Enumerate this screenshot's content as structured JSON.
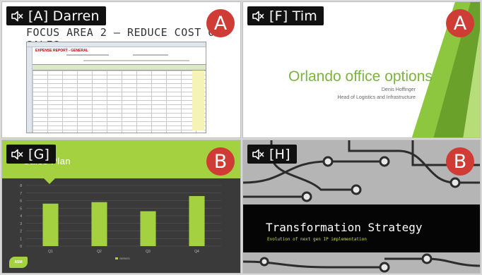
{
  "tiles": {
    "a": {
      "participant": "[A] Darren",
      "group": "A",
      "slide_title": "FOCUS AREA 2 — REDUCE COST OF SALES",
      "sheet_title": "EXPENSE REPORT - GENERAL"
    },
    "f": {
      "participant": "[F] Tim",
      "group": "A",
      "slide_title": "Orlando office options",
      "presenter_name": "Denis Hoffinger",
      "presenter_role": "Head of Logistics and Infrastructure"
    },
    "g": {
      "participant": "[G]",
      "group": "B",
      "slide_title": "Sales Plan",
      "logo_text": "ASM"
    },
    "h": {
      "participant": "[H]",
      "group": "B",
      "slide_title": "Transformation Strategy",
      "slide_subtitle": "Evolution of next gen IP implementation"
    }
  },
  "colors": {
    "badge_bg": "#111111",
    "group_badge": "#cf3b35",
    "green_accent": "#a3d13f",
    "title_green": "#7cb342"
  },
  "icons": {
    "mute": "speaker-muted-icon"
  },
  "chart_data": {
    "type": "bar",
    "categories": [
      "Q1",
      "Q2",
      "Q3",
      "Q4"
    ],
    "values": [
      5.6,
      5.8,
      4.6,
      6.6
    ],
    "ylim": [
      0,
      8
    ],
    "yticks": [
      "0",
      "1",
      "2",
      "3",
      "4",
      "5",
      "6",
      "7",
      "8"
    ],
    "legend": "SERIES",
    "grid": true,
    "bar_color": "#a3d13f"
  }
}
